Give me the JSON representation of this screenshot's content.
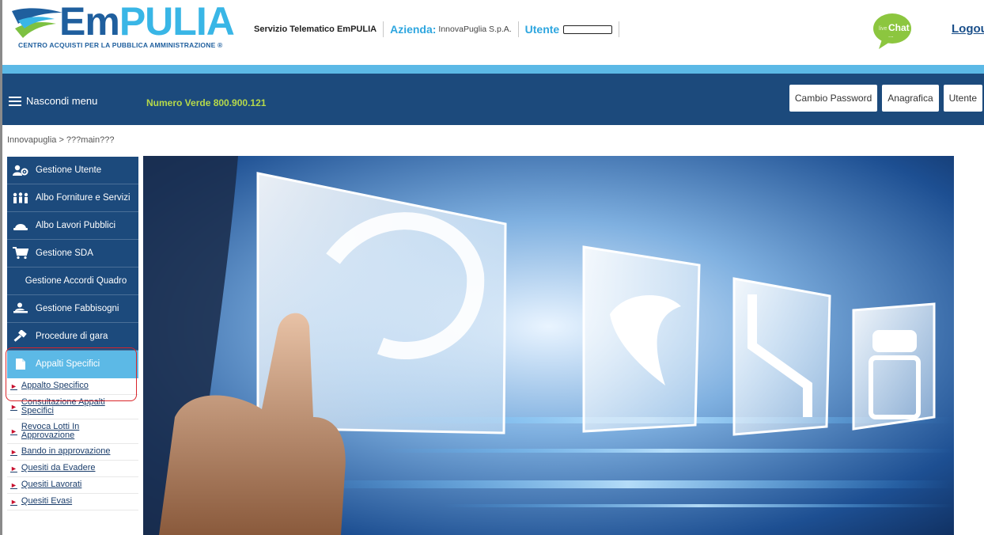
{
  "brand": {
    "logo_em": "Em",
    "logo_pulia": "PULIA",
    "logo_subtitle": "CENTRO ACQUISTI PER LA PUBBLICA AMMINISTRAZIONE ®"
  },
  "header": {
    "service": "Servizio Telematico EmPULIA",
    "azienda_label": "Azienda:",
    "azienda_value": "InnovaPuglia S.p.A.",
    "utente_label": "Utente",
    "chat_label": "Chat",
    "chat_prefix": "live",
    "logout": "Logout"
  },
  "nav": {
    "menu_toggle": "Nascondi menu",
    "numero_verde": "Numero Verde 800.900.121",
    "buttons": [
      "Cambio Password",
      "Anagrafica",
      "Utente"
    ]
  },
  "breadcrumb": "Innovapuglia > ???main???",
  "sidebar": {
    "items": [
      {
        "label": "Gestione Utente",
        "icon": "users-gear-icon"
      },
      {
        "label": "Albo Forniture e Servizi",
        "icon": "people-icon"
      },
      {
        "label": "Albo Lavori Pubblici",
        "icon": "hardhat-icon"
      },
      {
        "label": "Gestione SDA",
        "icon": "cart-icon"
      },
      {
        "label": "Gestione Accordi Quadro",
        "icon": ""
      },
      {
        "label": "Gestione Fabbisogni",
        "icon": "person-desk-icon"
      },
      {
        "label": "Procedure di gara",
        "icon": "gavel-icon"
      },
      {
        "label": "Appalti Specifici",
        "icon": "document-icon"
      }
    ],
    "subitems": [
      "Appalto Specifico",
      "Consultazione Appalti Specifici",
      "Revoca Lotti In Approvazione",
      "Bando in approvazione",
      "Quesiti da Evadere",
      "Quesiti Lavorati",
      "Quesiti Evasi"
    ]
  },
  "colors": {
    "navy": "#1c4a7c",
    "light_blue": "#5cb9e6",
    "green_accent": "#b6d94a",
    "highlight_red": "#d9252a"
  }
}
